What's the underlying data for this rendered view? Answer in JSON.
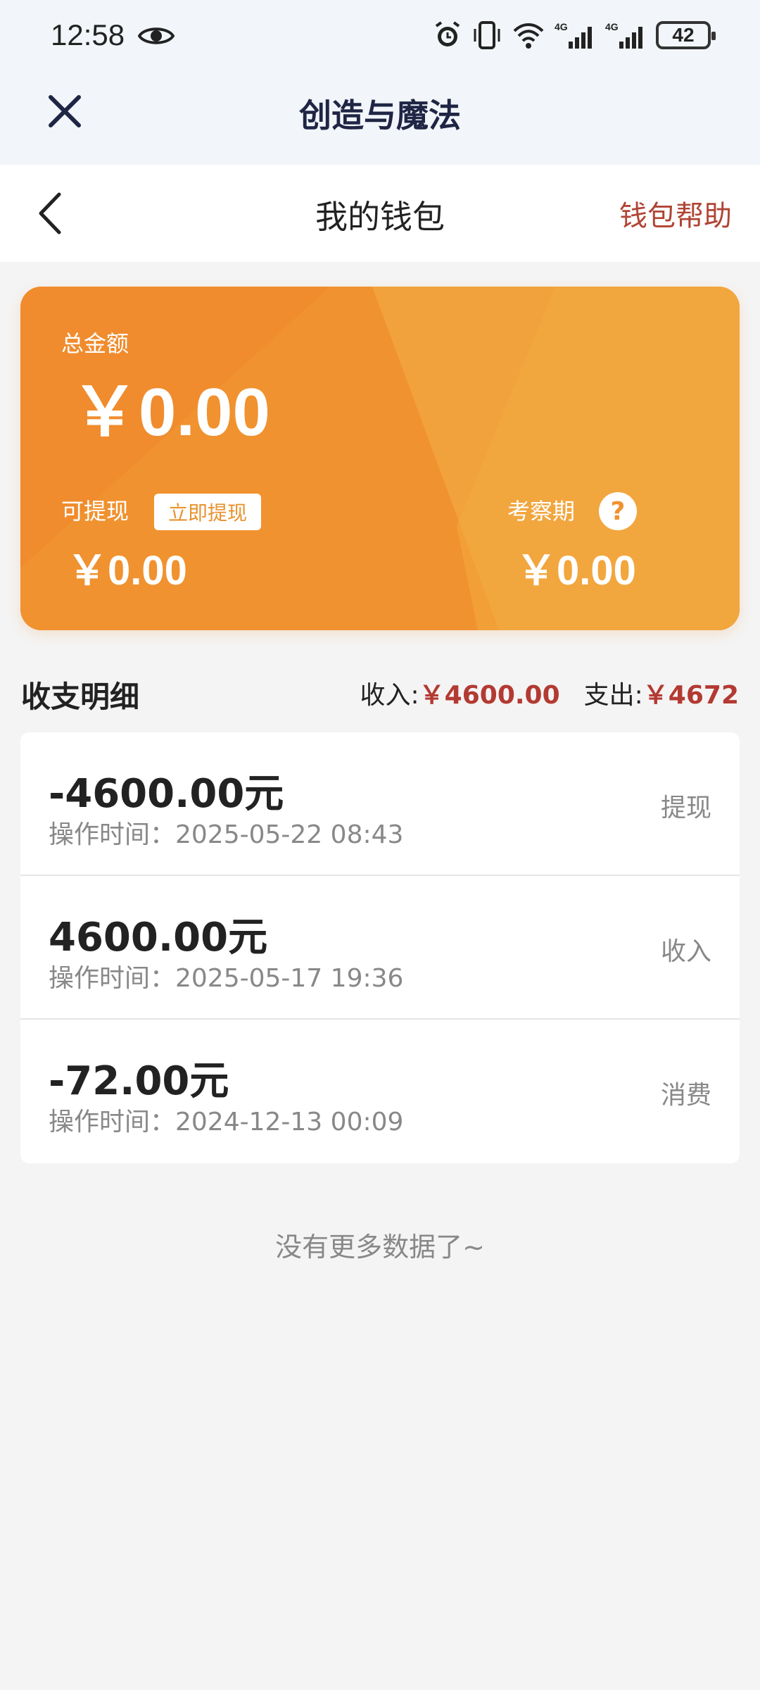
{
  "status_bar": {
    "time": "12:58",
    "battery": "42",
    "network_1": "4G",
    "network_2": "4G",
    "icons": [
      "eye-icon",
      "alarm-icon",
      "vibrate-icon",
      "wifi-icon",
      "signal-icon",
      "signal-icon",
      "battery-icon"
    ]
  },
  "app_bar": {
    "title": "创造与魔法",
    "close_icon": "close-icon"
  },
  "page_header": {
    "title": "我的钱包",
    "help_link": "钱包帮助",
    "back_icon": "chevron-left-icon"
  },
  "wallet": {
    "total_label": "总金额",
    "total_amount": "￥0.00",
    "withdrawable_label": "可提现",
    "withdraw_button": "立即提现",
    "withdrawable_amount": "￥0.00",
    "review_label": "考察期",
    "review_help": "?",
    "review_amount": "￥0.00",
    "colors": {
      "card_orange": "#f0922f",
      "accent_red": "#b04434"
    }
  },
  "summary": {
    "title": "收支明细",
    "income_label": "收入:",
    "income_value": "￥4600.00",
    "expense_label": "支出:",
    "expense_value": "￥4672"
  },
  "transactions": [
    {
      "amount": "-4600.00元",
      "time": "操作时间：2025-05-22 08:43",
      "type": "提现"
    },
    {
      "amount": "4600.00元",
      "time": "操作时间：2025-05-17 19:36",
      "type": "收入"
    },
    {
      "amount": "-72.00元",
      "time": "操作时间：2024-12-13 00:09",
      "type": "消费"
    }
  ],
  "footer": {
    "no_more": "没有更多数据了~"
  }
}
